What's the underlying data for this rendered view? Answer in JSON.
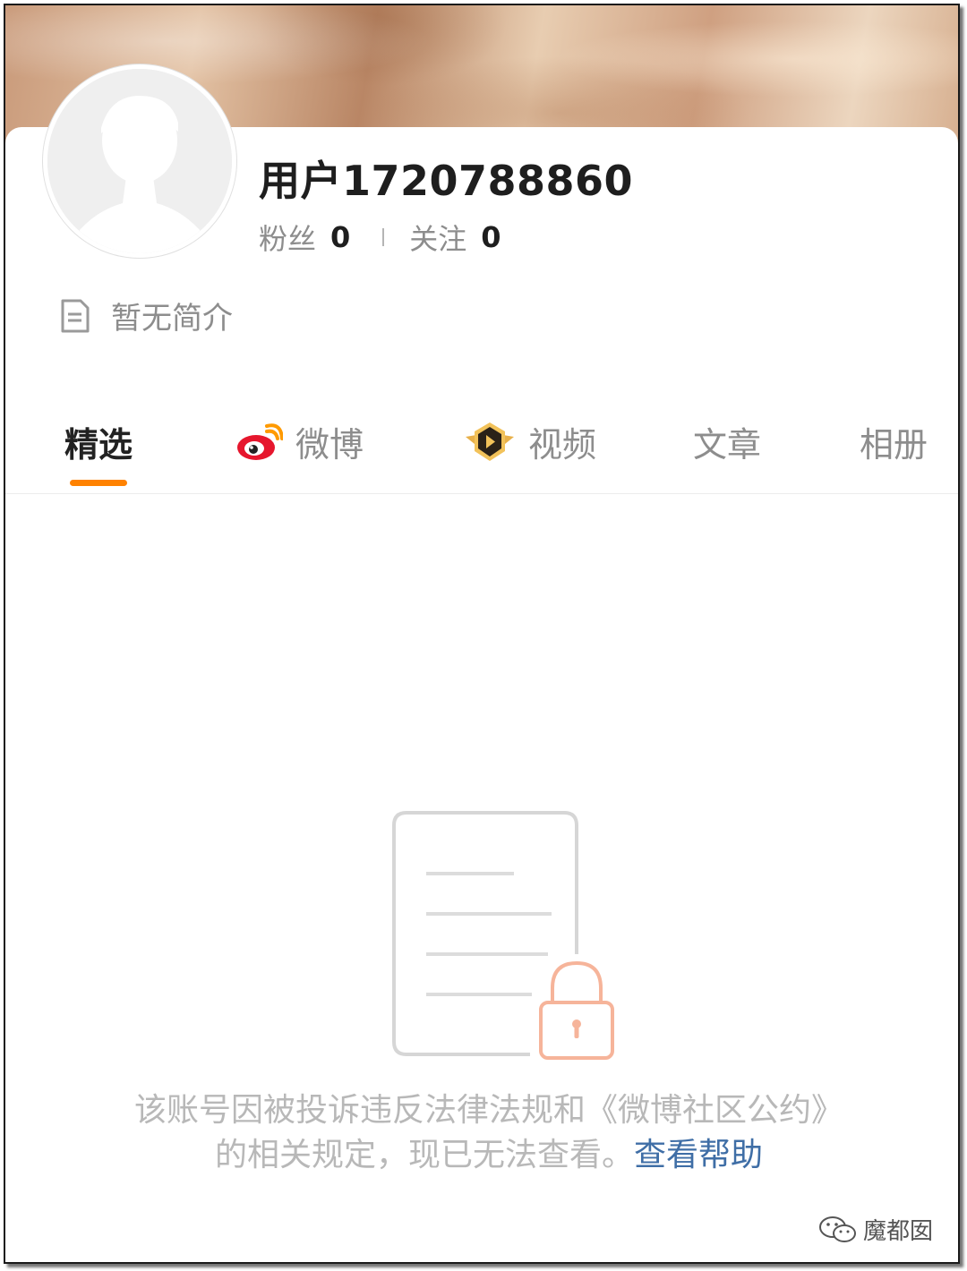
{
  "profile": {
    "username": "用户1720788860",
    "followers_label": "粉丝",
    "followers_count": "0",
    "following_label": "关注",
    "following_count": "0",
    "bio": "暂无简介"
  },
  "tabs": [
    {
      "label": "精选",
      "active": true
    },
    {
      "label": "微博",
      "icon": "weibo-logo-icon"
    },
    {
      "label": "视频",
      "icon": "video-badge-icon"
    },
    {
      "label": "文章"
    },
    {
      "label": "相册"
    }
  ],
  "notice": {
    "text": "该账号因被投诉违反法律法规和《微博社区公约》的相关规定，现已无法查看。",
    "link_label": "查看帮助"
  },
  "watermark": {
    "label": "魔都囡",
    "icon": "wechat-icon"
  },
  "colors": {
    "accent": "#ff8200",
    "link": "#3f6ea6",
    "lock": "#f6b49a"
  }
}
